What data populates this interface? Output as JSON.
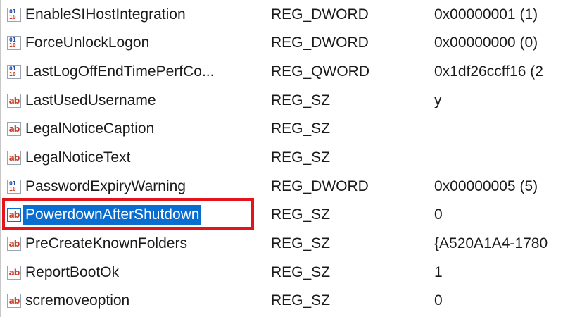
{
  "registry_values": [
    {
      "name": "EnableSIHostIntegration",
      "type": "REG_DWORD",
      "data": "0x00000001 (1)",
      "icon": "binary-value-icon",
      "selected": false
    },
    {
      "name": "ForceUnlockLogon",
      "type": "REG_DWORD",
      "data": "0x00000000 (0)",
      "icon": "binary-value-icon",
      "selected": false
    },
    {
      "name": "LastLogOffEndTimePerfCo...",
      "type": "REG_QWORD",
      "data": "0x1df26ccff16 (2",
      "icon": "binary-value-icon",
      "selected": false
    },
    {
      "name": "LastUsedUsername",
      "type": "REG_SZ",
      "data": "y",
      "icon": "string-value-icon",
      "selected": false
    },
    {
      "name": "LegalNoticeCaption",
      "type": "REG_SZ",
      "data": "",
      "icon": "string-value-icon",
      "selected": false
    },
    {
      "name": "LegalNoticeText",
      "type": "REG_SZ",
      "data": "",
      "icon": "string-value-icon",
      "selected": false
    },
    {
      "name": "PasswordExpiryWarning",
      "type": "REG_DWORD",
      "data": "0x00000005 (5)",
      "icon": "binary-value-icon",
      "selected": false
    },
    {
      "name": "PowerdownAfterShutdown",
      "type": "REG_SZ",
      "data": "0",
      "icon": "string-value-icon",
      "selected": true
    },
    {
      "name": "PreCreateKnownFolders",
      "type": "REG_SZ",
      "data": "{A520A1A4-1780",
      "icon": "string-value-icon",
      "selected": false
    },
    {
      "name": "ReportBootOk",
      "type": "REG_SZ",
      "data": "1",
      "icon": "string-value-icon",
      "selected": false
    },
    {
      "name": "scremoveoption",
      "type": "REG_SZ",
      "data": "0",
      "icon": "string-value-icon",
      "selected": false
    }
  ],
  "icon_text": {
    "binary_top": "01",
    "binary_bottom": "10",
    "string": "ab"
  },
  "colors": {
    "selection": "#0a6ed1",
    "highlight_box": "#e3141b"
  }
}
